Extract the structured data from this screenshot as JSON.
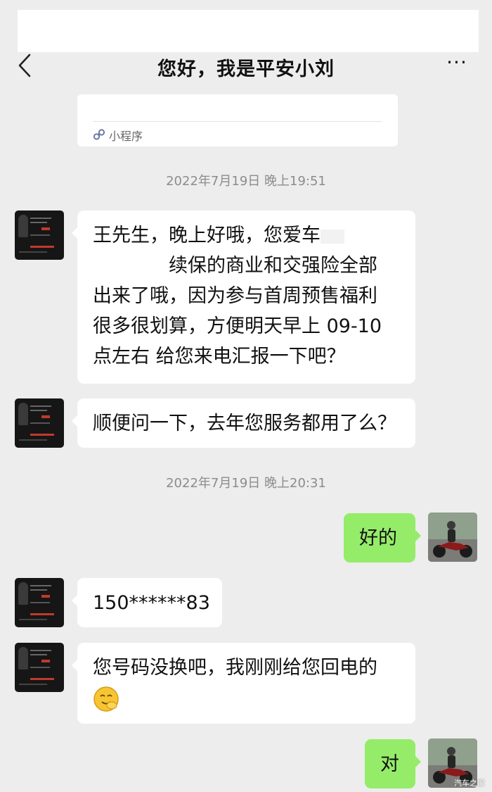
{
  "header": {
    "title": "您好，我是平安小刘",
    "back_icon": "chevron-left-icon",
    "more_label": "···"
  },
  "mini_program_card": {
    "label": "小程序",
    "icon": "mini-program-link-icon"
  },
  "messages": [
    {
      "type": "timestamp",
      "text": "2022年7月19日 晚上19:51"
    },
    {
      "type": "incoming",
      "lines": [
        "王先生，晚上好哦，您爱车",
        "续保的商业和交强险全部",
        "出来了哦，因为参与首周预售福利",
        "很多很划算，方便明天早上 09-10",
        "点左右 给您来电汇报一下吧？"
      ]
    },
    {
      "type": "incoming",
      "text": "顺便问一下，去年您服务都用了么？"
    },
    {
      "type": "timestamp",
      "text": "2022年7月19日 晚上20:31"
    },
    {
      "type": "outgoing",
      "text": "好的"
    },
    {
      "type": "incoming",
      "text": "150******83"
    },
    {
      "type": "incoming",
      "text": "您号码没换吧，我刚刚给您回电的",
      "emoji": "hug-face-emoji"
    },
    {
      "type": "outgoing",
      "text": "对"
    }
  ],
  "watermark": "汽车之家",
  "colors": {
    "background": "#ededed",
    "incoming_bubble": "#ffffff",
    "outgoing_bubble": "#95ec69",
    "timestamp_text": "#8c8c8c"
  }
}
